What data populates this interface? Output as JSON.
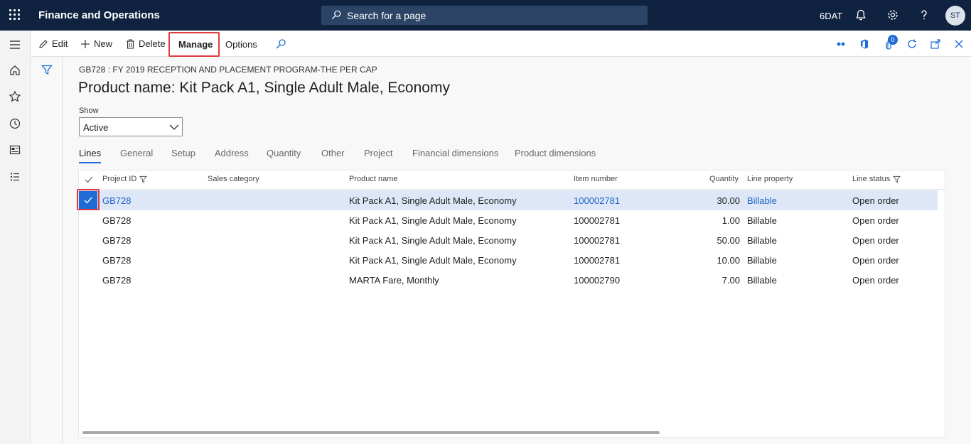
{
  "app": {
    "title": "Finance and Operations"
  },
  "search": {
    "placeholder": "Search for a page"
  },
  "topbar": {
    "company": "6DAT",
    "avatar_initials": "ST"
  },
  "actions": {
    "edit": "Edit",
    "new": "New",
    "delete": "Delete",
    "manage": "Manage",
    "options": "Options",
    "attachment_count": "0"
  },
  "page": {
    "breadcrumb": "GB728 : FY 2019 RECEPTION AND PLACEMENT PROGRAM-THE PER CAP",
    "title": "Product name: Kit Pack A1, Single Adult Male, Economy",
    "show_label": "Show",
    "show_value": "Active"
  },
  "tabs": [
    "Lines",
    "General",
    "Setup",
    "Address",
    "Quantity",
    "Other",
    "Project",
    "Financial dimensions",
    "Product dimensions"
  ],
  "grid": {
    "columns": [
      "Project ID",
      "Sales category",
      "Product name",
      "Item number",
      "Quantity",
      "Line property",
      "Line status"
    ],
    "rows": [
      {
        "project_id": "GB728",
        "sales_category": "",
        "product_name": "Kit Pack A1, Single  Adult Male, Economy",
        "item_number": "100002781",
        "quantity": "30.00",
        "line_property": "Billable",
        "line_status": "Open order"
      },
      {
        "project_id": "GB728",
        "sales_category": "",
        "product_name": "Kit Pack A1, Single  Adult Male, Economy",
        "item_number": "100002781",
        "quantity": "1.00",
        "line_property": "Billable",
        "line_status": "Open order"
      },
      {
        "project_id": "GB728",
        "sales_category": "",
        "product_name": "Kit Pack A1, Single  Adult Male, Economy",
        "item_number": "100002781",
        "quantity": "50.00",
        "line_property": "Billable",
        "line_status": "Open order"
      },
      {
        "project_id": "GB728",
        "sales_category": "",
        "product_name": "Kit Pack A1, Single  Adult Male, Economy",
        "item_number": "100002781",
        "quantity": "10.00",
        "line_property": "Billable",
        "line_status": "Open order"
      },
      {
        "project_id": "GB728",
        "sales_category": "",
        "product_name": "MARTA Fare, Monthly",
        "item_number": "100002790",
        "quantity": "7.00",
        "line_property": "Billable",
        "line_status": "Open order"
      }
    ]
  },
  "colors": {
    "topbar": "#0f2240",
    "accent": "#1f6bd6",
    "highlight_box": "#e0393e",
    "selected_row": "#dde7f7"
  }
}
